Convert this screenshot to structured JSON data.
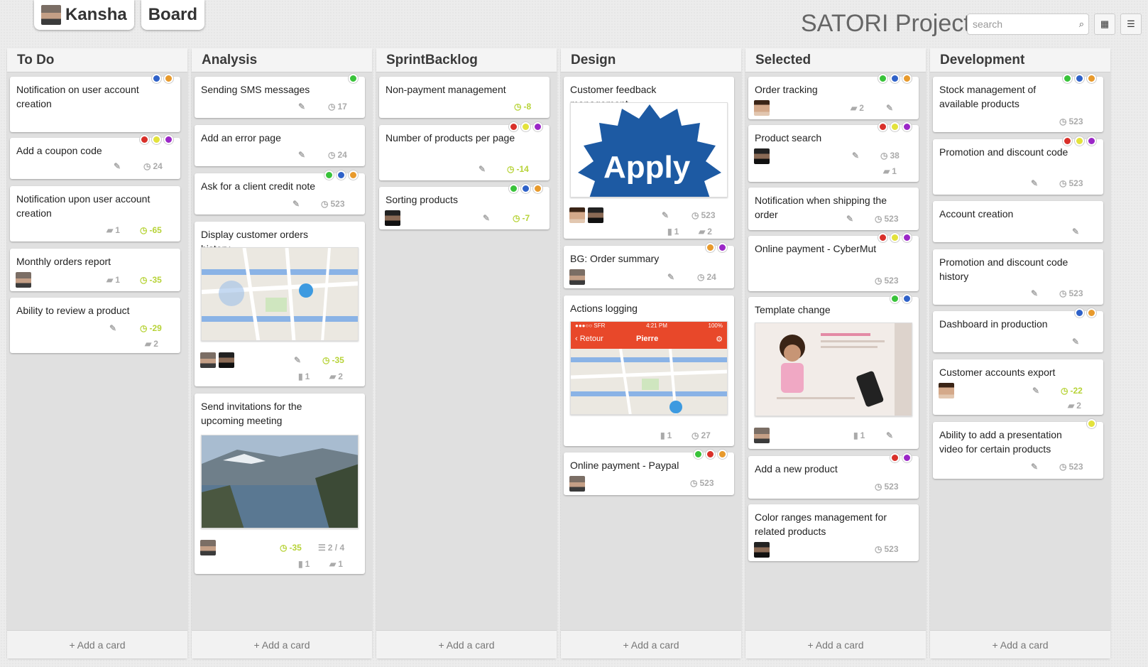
{
  "header": {
    "user_tab": "Kansha",
    "board_tab": "Board",
    "project_title": "SATORI Project",
    "search_placeholder": "search"
  },
  "colors": {
    "red": "#d9302a",
    "yellow": "#e3e23c",
    "purple": "#9b27c7",
    "blue": "#2f62c9",
    "orange": "#e89a2c",
    "green": "#39c33a",
    "accent_green": "#b7d338"
  },
  "add_card_label": "+ Add a card",
  "lanes": [
    {
      "title": "To Do",
      "cards": [
        {
          "title": "Notification on user account creation"
        },
        {
          "title": "Add a coupon code",
          "due": "24"
        },
        {
          "title": "Notification upon user account creation",
          "comments": "1",
          "due": "-65"
        },
        {
          "title": "Monthly orders report",
          "comments": "1",
          "due": "-35"
        },
        {
          "title": "Ability to review a product",
          "due": "-29",
          "comments": "2"
        }
      ]
    },
    {
      "title": "Analysis",
      "cards": [
        {
          "title": "Sending SMS messages",
          "due": "17"
        },
        {
          "title": "Add an error page",
          "due": "24"
        },
        {
          "title": "Ask for a client credit note",
          "due": "523"
        },
        {
          "title": "Display customer orders history",
          "due": "-35",
          "files": "1",
          "comments": "2"
        },
        {
          "title": "Send invitations for the upcoming meeting",
          "due": "-35",
          "checklist": "2 / 4",
          "files": "1",
          "comments": "1"
        }
      ]
    },
    {
      "title": "SprintBacklog",
      "cards": [
        {
          "title": "Non-payment management",
          "due": "-8"
        },
        {
          "title": "Number of products per page",
          "due": "-14"
        },
        {
          "title": "Sorting products",
          "due": "-7"
        }
      ]
    },
    {
      "title": "Design",
      "cards": [
        {
          "title": "Customer feedback management",
          "image_text": "Apply",
          "due": "523",
          "files": "1",
          "comments": "2"
        },
        {
          "title": "BG: Order summary",
          "due": "24"
        },
        {
          "title": "Actions logging",
          "files": "1",
          "due": "27",
          "phone": {
            "carrier": "●●●○○ SFR",
            "time": "4:21 PM",
            "battery": "100%",
            "back": "Retour",
            "name": "Pierre"
          }
        },
        {
          "title": "Online payment - Paypal",
          "due": "523"
        }
      ]
    },
    {
      "title": "Selected",
      "cards": [
        {
          "title": "Order tracking",
          "comments": "2"
        },
        {
          "title": "Product search",
          "due": "38",
          "comments": "1"
        },
        {
          "title": "Notification when shipping the order",
          "due": "523"
        },
        {
          "title": "Online payment - CyberMut",
          "due": "523"
        },
        {
          "title": "Template change",
          "files": "1"
        },
        {
          "title": "Add a new product",
          "due": "523"
        },
        {
          "title": "Color ranges management for related products",
          "due": "523"
        }
      ]
    },
    {
      "title": "Development",
      "cards": [
        {
          "title": "Stock management of available products",
          "due": "523"
        },
        {
          "title": "Promotion and discount code",
          "due": "523"
        },
        {
          "title": "Account creation"
        },
        {
          "title": "Promotion and discount code history",
          "due": "523"
        },
        {
          "title": "Dashboard in production"
        },
        {
          "title": "Customer accounts export",
          "due": "-22",
          "comments": "2"
        },
        {
          "title": "Ability to add a presentation video for certain products",
          "due": "523"
        }
      ]
    }
  ]
}
